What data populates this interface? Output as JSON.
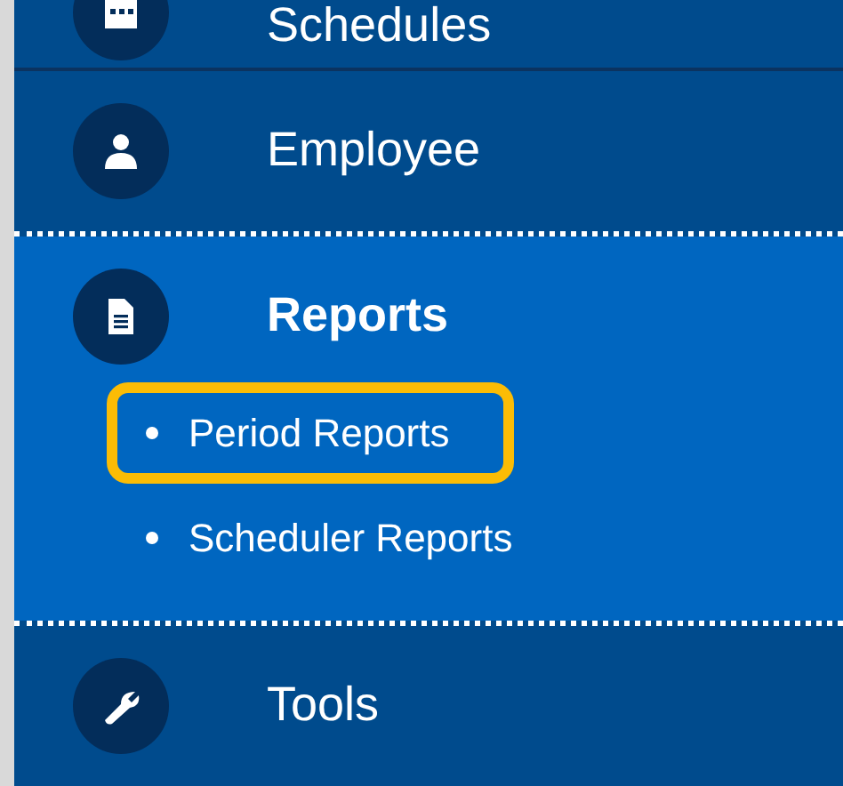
{
  "menu": [
    {
      "kind": "calendar",
      "label": "Schedules",
      "selected": false
    },
    {
      "kind": "person",
      "label": "Employee",
      "selected": false
    },
    {
      "kind": "document",
      "label": "Reports",
      "selected": true,
      "children": [
        {
          "label": "Period Reports",
          "highlighted": true
        },
        {
          "label": "Scheduler Reports",
          "highlighted": false
        }
      ]
    },
    {
      "kind": "wrench",
      "label": "Tools",
      "selected": false
    }
  ]
}
